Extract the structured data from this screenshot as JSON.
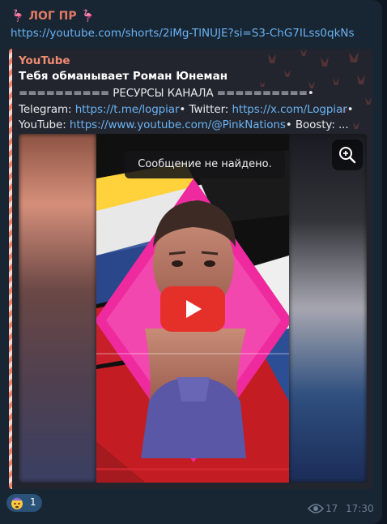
{
  "channel": {
    "name": "ЛОГ ПР",
    "emoji": "🦩"
  },
  "message": {
    "link": "https://youtube.com/shorts/2iMg-TlNUJE?si=S3-ChG7ILss0qkNs"
  },
  "preview": {
    "site": "YouTube",
    "title": "Тебя обманывает Роман Юнеман",
    "desc_prefix": "========== РЕСУРСЫ КАНАЛА ==========• Telegram:",
    "tg_link": "https://t.me/logpiar",
    "twitter_label": "• Twitter:",
    "x_link": "https://x.com/Logpiar",
    "youtube_label": "• YouTube:",
    "yt_link": "https://www.youtube.com/@PinkNations",
    "boosty_label": "• Boosty: ..."
  },
  "media": {
    "toast": "Сообщение не найдено."
  },
  "reaction": {
    "emoji": "🤯",
    "count": "1"
  },
  "footer": {
    "views": "17",
    "time": "17:30"
  },
  "icons": [
    "zoom-icon",
    "play-icon",
    "eye-icon",
    "flamingo-icon",
    "exploding-head-icon"
  ],
  "colors": {
    "accent": "#e17b63",
    "link": "#6ab3f3",
    "background": "#0e1621",
    "bubble": "#182533",
    "play": "#e5302a"
  }
}
